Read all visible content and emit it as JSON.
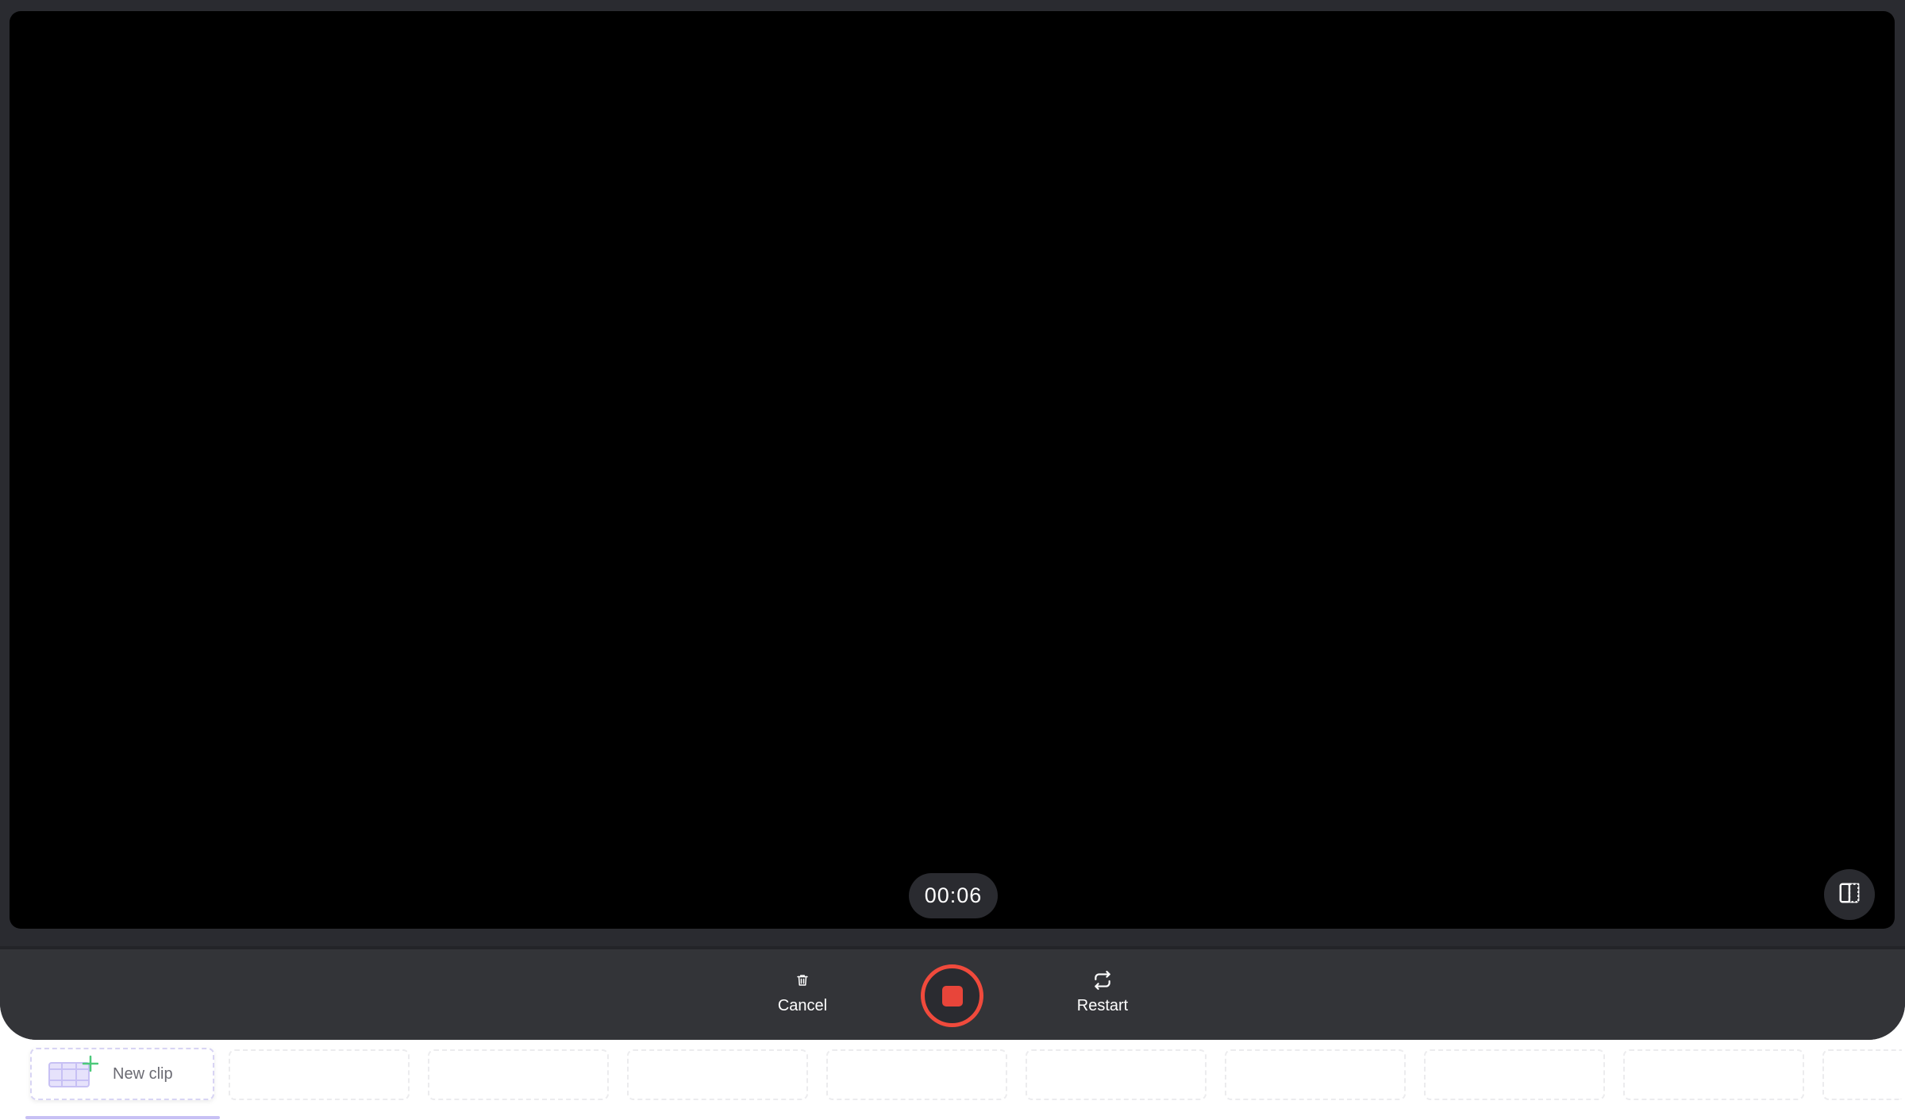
{
  "recorder": {
    "timer": "00:06",
    "cancel_label": "Cancel",
    "restart_label": "Restart",
    "stop_aria": "Stop recording"
  },
  "clips": {
    "new_clip_label": "New clip",
    "empty_slot_count": 9
  },
  "colors": {
    "shell_bg": "#2a2b30",
    "control_bar_bg": "#333438",
    "record_red": "#f04a3c",
    "accent_purple": "#c7c0f4",
    "plus_green": "#4cc97a"
  },
  "icons": {
    "cancel": "trash-icon",
    "restart": "repeat-icon",
    "stop": "stop-icon",
    "split": "split-view-icon",
    "new_clip": "film-plus-icon"
  }
}
